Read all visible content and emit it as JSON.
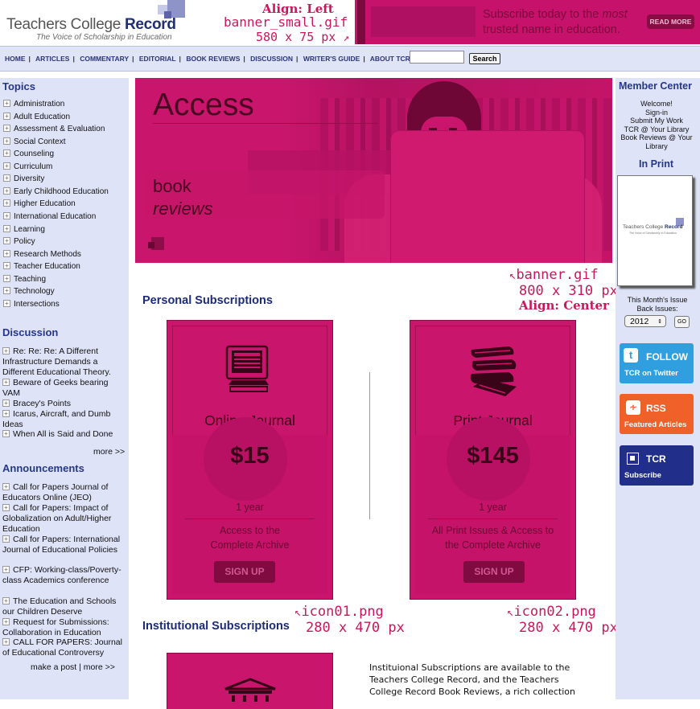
{
  "header": {
    "logo_title_a": "Teachers College ",
    "logo_title_b": "Record",
    "logo_tagline": "The Voice of Scholarship in Education",
    "note_align": "Align: Left",
    "note_file": "banner_small.gif",
    "note_size": "580 x 75 px",
    "ad_line1_a": "Subscribe today to the ",
    "ad_line1_em": "most",
    "ad_line2": "trusted name in education.",
    "ad_button": "READ MORE"
  },
  "nav": {
    "items": [
      "HOME",
      "ARTICLES",
      "COMMENTARY",
      "EDITORIAL",
      "BOOK REVIEWS",
      "DISCUSSION",
      "WRITER'S GUIDE",
      "ABOUT TCRECORD"
    ],
    "search_value": "",
    "search_button": "Search"
  },
  "left": {
    "topics_title": "Topics",
    "topics": [
      "Administration",
      "Adult Education",
      "Assessment & Evaluation",
      "Social Context",
      "Counseling",
      "Curriculum",
      "Diversity",
      "Early Childhood Education",
      "Higher Education",
      "International Education",
      "Learning",
      "Policy",
      "Research Methods",
      "Teacher Education",
      "Teaching",
      "Technology",
      "Intersections"
    ],
    "discussion_title": "Discussion",
    "discussion": [
      "Re: Re: Re: A Different Infrastructure Demands a Different Educational Theory.",
      "Beware of Geeks bearing VAM",
      "Bracey's Points",
      "Icarus, Aircraft, and Dumb Ideas",
      "When All is Said and Done"
    ],
    "discussion_more": "more >>",
    "announcements_title": "Announcements",
    "announcements": [
      "Call for Papers Journal of Educators Online (JEO)",
      "Call for Papers: Impact of Globalization on Adult/Higher Education",
      "Call for Papers: International Journal of Educational Policies",
      "CFP: Working-class/Poverty-class Academics conference",
      "The Education and Schools our Children Deserve",
      "Request for Submissions: Collaboration in Education",
      "CALL FOR PAPERS: Journal of Educational Controversy"
    ],
    "make_post": "make a post",
    "announce_more": "more >>"
  },
  "banner": {
    "heading": "Access",
    "line1": "book",
    "line2": "reviews",
    "note_file": "banner.gif",
    "note_size": "800 x 310 px",
    "note_align": "Align: Center"
  },
  "personal": {
    "title": "Personal Subscriptions",
    "cards": [
      {
        "title": "Online Journal",
        "price": "$15",
        "term": "1 year",
        "desc1": "Access to the",
        "desc2": "Complete Archive",
        "button": "SIGN UP",
        "note_file": "icon01.png",
        "note_size": "280 x 470 px"
      },
      {
        "title": "Print Journal",
        "price": "$145",
        "term": "1 year",
        "desc1": "All Print Issues & Access to",
        "desc2": "the Complete Archive",
        "button": "SIGN UP",
        "note_file": "icon02.png",
        "note_size": "280 x 470 px"
      }
    ]
  },
  "institutional": {
    "title": "Institutional Subscriptions",
    "text_lines": [
      "Instituional Subscriptions are available to the",
      "Teachers College Record, and the Teachers",
      "College Record Book Reviews, a rich collection"
    ]
  },
  "right": {
    "member_title": "Member Center",
    "member_links": [
      "Welcome!",
      "Sign-in",
      "Submit My Work",
      "TCR @ Your Library",
      "Book Reviews @ Your Library"
    ],
    "inprint_title": "In Print",
    "cover_title_a": "Teachers College ",
    "cover_title_b": "Record",
    "cover_tag": "The Voice of Scholarship in Education",
    "issue_label1": "This Month's Issue",
    "issue_label2": "Back Issues:",
    "year": "2012",
    "go": "GO",
    "twitter_line1": "FOLLOW",
    "twitter_line2": "TCR on Twitter",
    "rss_line1": "RSS",
    "rss_line2": "Featured Articles",
    "tcr_line1": "TCR",
    "tcr_line2": "Subscribe",
    "colors": {
      "twitter": "#2f9fe0",
      "rss": "#f0612a",
      "tcr": "#222f8a"
    }
  },
  "colors": {
    "accent": "#c9166c",
    "navy": "#1d2b78",
    "sidebar": "#dfe3f8"
  }
}
